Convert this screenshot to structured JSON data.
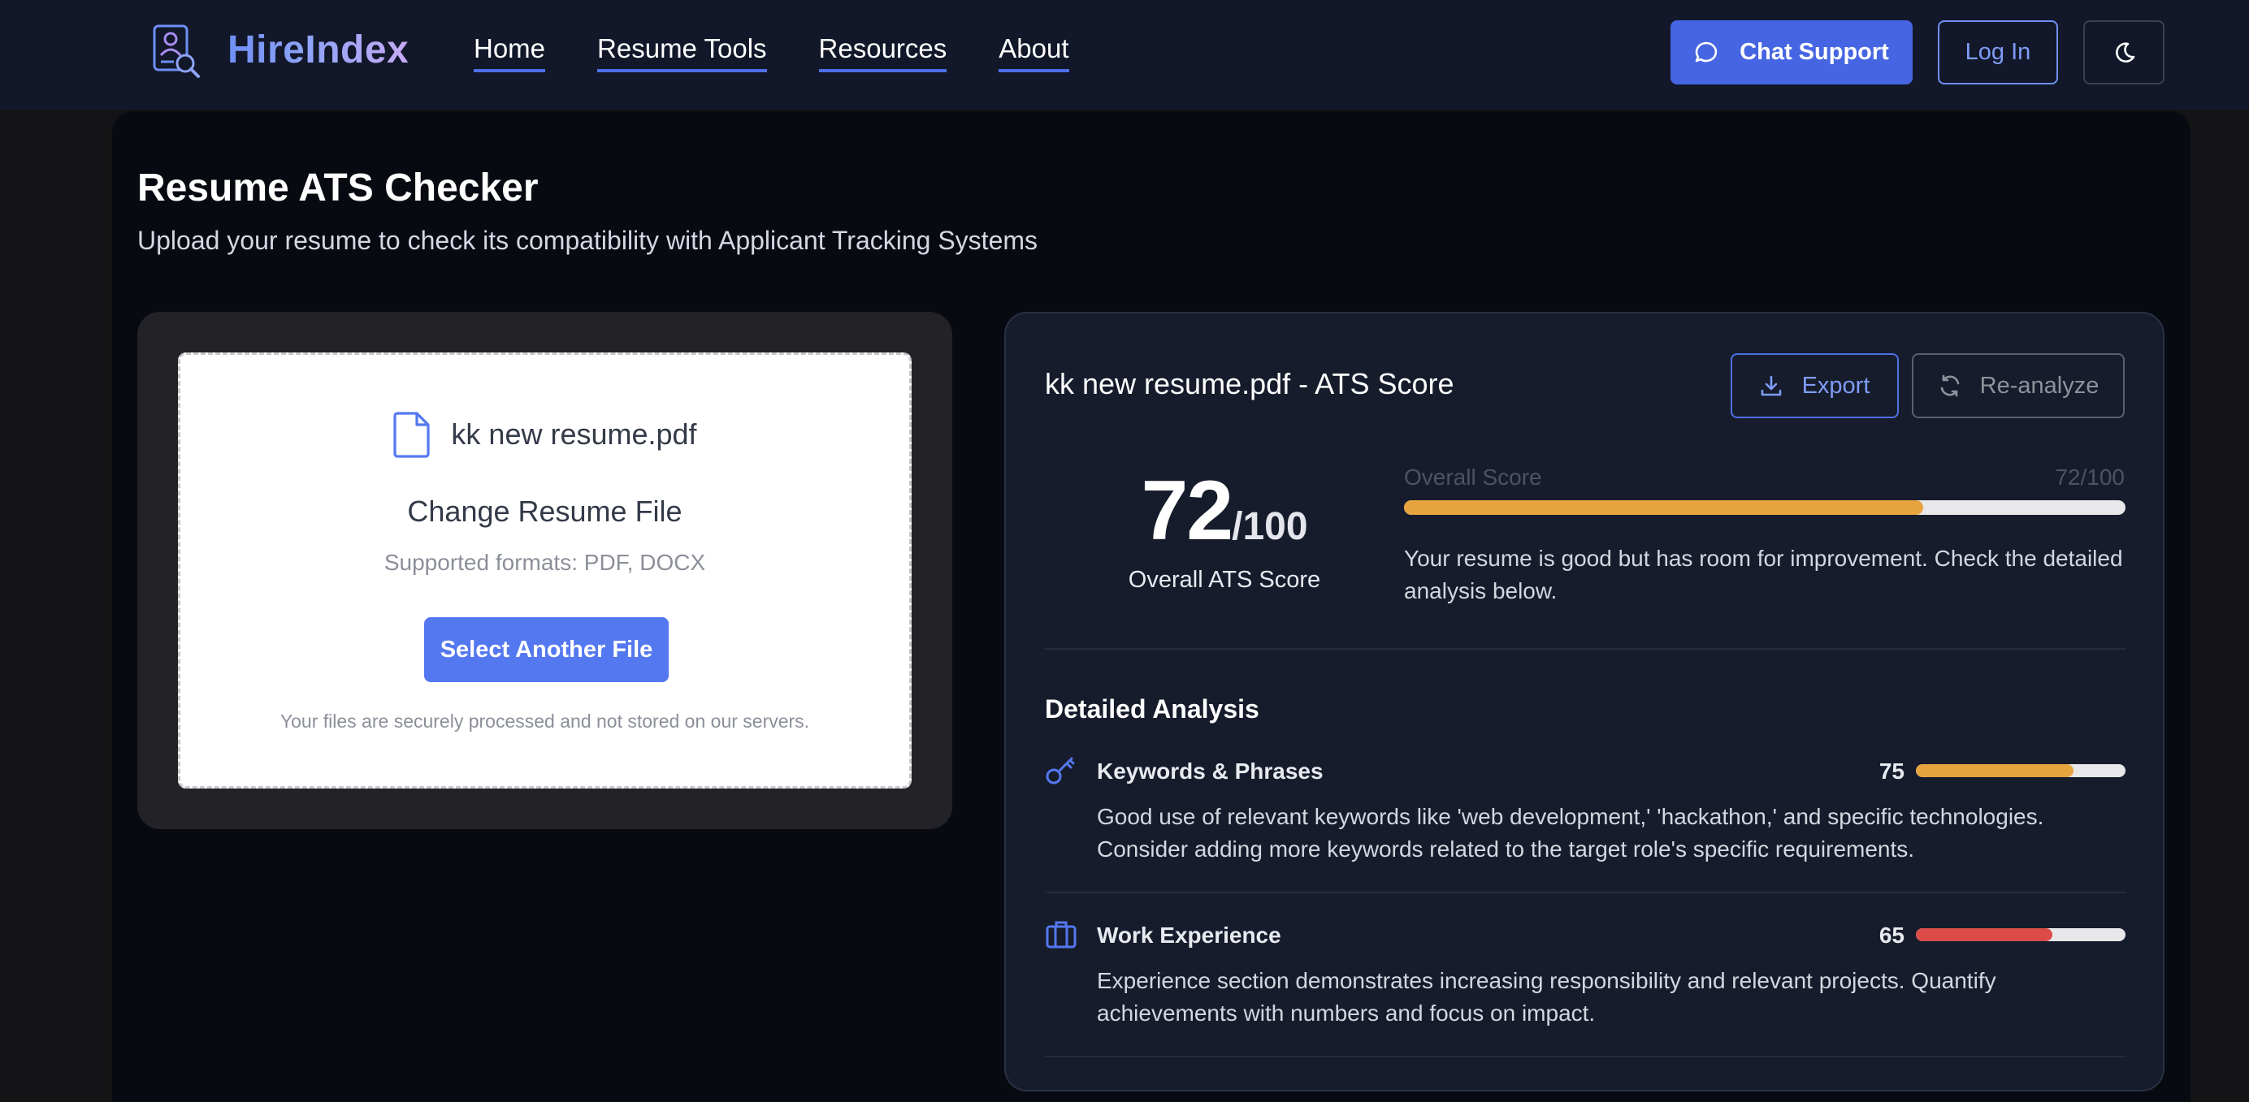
{
  "header": {
    "brand": "HireIndex",
    "nav": [
      "Home",
      "Resume Tools",
      "Resources",
      "About"
    ],
    "chat_label": "Chat Support",
    "login_label": "Log In"
  },
  "page": {
    "title": "Resume ATS Checker",
    "subtitle": "Upload your resume to check its compatibility with Applicant Tracking Systems"
  },
  "upload": {
    "file_name": "kk new resume.pdf",
    "change_title": "Change Resume File",
    "formats": "Supported formats: PDF, DOCX",
    "select_label": "Select Another File",
    "secure_note": "Your files are securely processed and not stored on our servers."
  },
  "result": {
    "title": "kk new resume.pdf - ATS Score",
    "export_label": "Export",
    "reanalyze_label": "Re-analyze",
    "score": "72",
    "score_max": "/100",
    "score_caption": "Overall ATS Score",
    "overall_label": "Overall Score",
    "overall_value": "72/100",
    "overall_fraction": 0.72,
    "summary": "Your resume is good but has room for improvement. Check the detailed analysis below.",
    "analysis_title": "Detailed Analysis",
    "items": [
      {
        "label": "Keywords & Phrases",
        "score": "75",
        "fraction": 0.75,
        "color": "#e7a33e",
        "icon": "key-icon",
        "desc": "Good use of relevant keywords like 'web development,' 'hackathon,' and specific technologies. Consider adding more keywords related to the target role's specific requirements."
      },
      {
        "label": "Work Experience",
        "score": "65",
        "fraction": 0.65,
        "color": "#dc4b48",
        "icon": "briefcase-icon",
        "desc": "Experience section demonstrates increasing responsibility and relevant projects. Quantify achievements with numbers and focus on impact."
      }
    ]
  },
  "colors": {
    "accent": "#4665e2",
    "overall_bar": "#e7a33e"
  }
}
